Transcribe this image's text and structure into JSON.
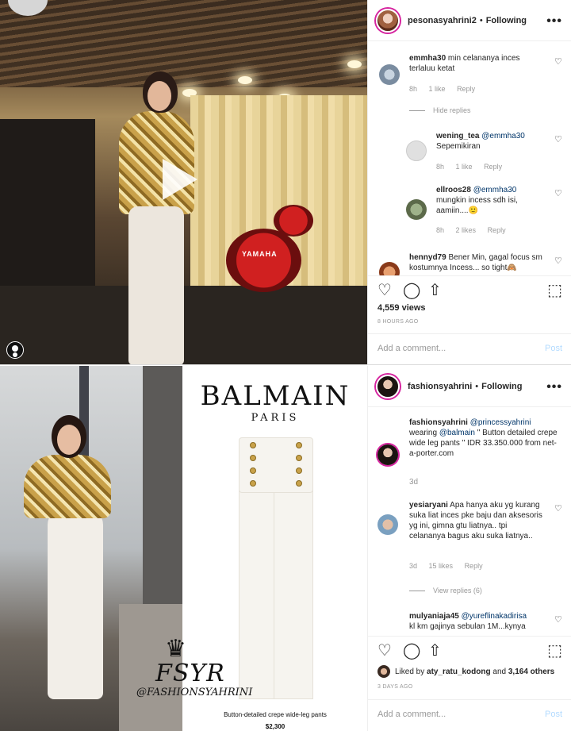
{
  "post1": {
    "username": "pesonasyahrini2",
    "follow_state": "Following",
    "drum_brand": "YAMAHA",
    "comments": [
      {
        "user": "emmha30",
        "text": "min celananya inces terlaluu ketat",
        "time": "8h",
        "likes": "1 like",
        "reply": "Reply"
      },
      {
        "hide_replies": "Hide replies"
      },
      {
        "user": "wening_tea",
        "mention": "@emmha30",
        "text": "Sepemikiran",
        "time": "8h",
        "likes": "1 like",
        "reply": "Reply"
      },
      {
        "user": "ellroos28",
        "mention": "@emmha30",
        "text": "mungkin incess sdh isi, aamiin....🙂",
        "time": "8h",
        "likes": "2 likes",
        "reply": "Reply"
      },
      {
        "user": "hennyd79",
        "text": "Bener Min, gagal focus sm kostumnya Incess... so tight🙈"
      }
    ],
    "views": "4,559 views",
    "timestamp": "8 HOURS AGO",
    "add_placeholder": "Add a comment...",
    "post_label": "Post"
  },
  "post2": {
    "username": "fashionsyahrini",
    "follow_state": "Following",
    "brand": "BALMAIN",
    "brand_city": "PARIS",
    "product_name": "Button-detailed crepe wide-leg pants",
    "product_price": "$2,300",
    "watermark_big": "FSYR",
    "watermark_small": "@FASHIONSYAHRINI",
    "caption": {
      "user": "fashionsyahrini",
      "mention1": "@princessyahrini",
      "pre": "wearing",
      "mention2": "@balmain",
      "text": "\" Button detailed crepe wide leg pants \" IDR 33.350.000 from net-a-porter.com",
      "time": "3d"
    },
    "comments": [
      {
        "user": "yesiaryani",
        "text": "Apa hanya aku yg kurang suka liat inces pke baju dan aksesoris yg ini, gimna gtu liatnya.. tpi celananya bagus aku suka liatnya..",
        "time": "3d",
        "likes": "15 likes",
        "reply": "Reply"
      },
      {
        "view_replies": "View replies (6)"
      },
      {
        "user": "mulyaniaja45",
        "mention": "@yureflinakadirisa",
        "text": "kl km gajinya sebulan 1M...kynya"
      }
    ],
    "liked_by_user": "aty_ratu_kodong",
    "liked_others": "3,164 others",
    "liked_prefix": "Liked by",
    "liked_and": "and",
    "timestamp": "3 DAYS AGO",
    "add_placeholder": "Add a comment...",
    "post_label": "Post"
  },
  "icons": {
    "heart": "♡",
    "comment": "◯",
    "share": "⇧",
    "bookmark": "⬚",
    "more": "•••"
  }
}
